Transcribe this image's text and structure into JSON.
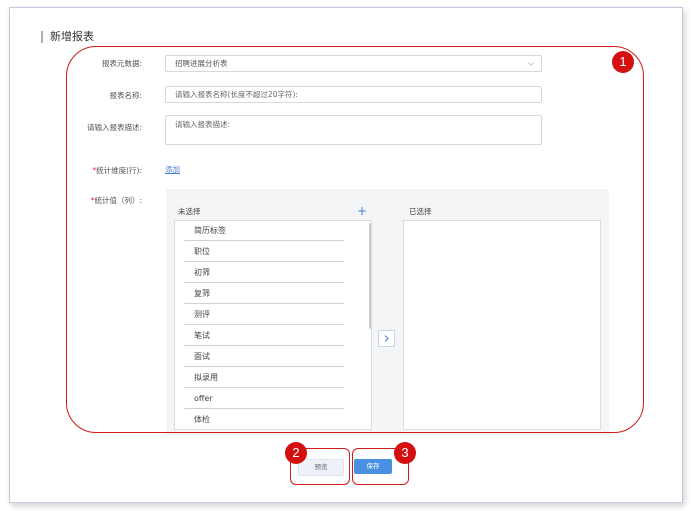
{
  "page": {
    "title": "新增报表"
  },
  "form": {
    "source_label": "报表元数据:",
    "source_value": "招聘进展分析表",
    "name_label": "报表名称:",
    "name_placeholder": "请输入报表名称(长度不超过20字符):",
    "desc_label": "请输入报表描述:",
    "desc_placeholder": "请输入报表描述:",
    "required_mark": "*",
    "dimension_label": "统计维度(行):",
    "dimension_add": "添加",
    "value_label": "统计值（列）:"
  },
  "transfer": {
    "left_title": "未选择",
    "right_title": "已选择",
    "add_symbol": "+",
    "left_items": [
      "简历标签",
      "职位",
      "初筛",
      "复筛",
      "测评",
      "笔试",
      "面试",
      "拟录用",
      "offer",
      "体检"
    ]
  },
  "actions": {
    "preview_label": "预览",
    "save_label": "保存"
  },
  "annotations": {
    "n1": "1",
    "n2": "2",
    "n3": "3"
  },
  "colors": {
    "accent": "#4a90e2",
    "annotation": "#d30f0f",
    "required": "#e22233"
  }
}
